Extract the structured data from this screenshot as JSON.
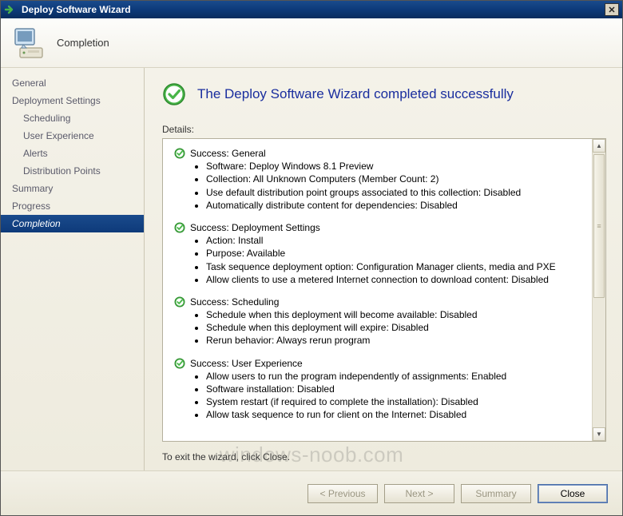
{
  "titlebar": {
    "title": "Deploy Software Wizard"
  },
  "header": {
    "step_title": "Completion"
  },
  "sidebar": {
    "items": [
      {
        "label": "General",
        "indent": false
      },
      {
        "label": "Deployment Settings",
        "indent": false
      },
      {
        "label": "Scheduling",
        "indent": true
      },
      {
        "label": "User Experience",
        "indent": true
      },
      {
        "label": "Alerts",
        "indent": true
      },
      {
        "label": "Distribution Points",
        "indent": true
      },
      {
        "label": "Summary",
        "indent": false
      },
      {
        "label": "Progress",
        "indent": false
      },
      {
        "label": "Completion",
        "indent": false,
        "active": true
      }
    ]
  },
  "main": {
    "headline": "The Deploy Software Wizard completed successfully",
    "details_label": "Details:",
    "sections": [
      {
        "title": "Success: General",
        "items": [
          "Software: Deploy Windows 8.1 Preview",
          "Collection: All Unknown Computers (Member Count: 2)",
          "Use default distribution point groups associated to this collection: Disabled",
          "Automatically distribute content for dependencies: Disabled"
        ]
      },
      {
        "title": "Success: Deployment Settings",
        "items": [
          "Action: Install",
          "Purpose: Available",
          "Task sequence deployment option: Configuration Manager clients, media and PXE",
          "Allow clients to use a metered Internet connection to download content: Disabled"
        ]
      },
      {
        "title": "Success: Scheduling",
        "items": [
          "Schedule when this deployment will become available: Disabled",
          "Schedule when this deployment will expire: Disabled",
          "Rerun behavior: Always rerun program"
        ]
      },
      {
        "title": "Success: User Experience",
        "items": [
          "Allow users to run the program independently of assignments: Enabled",
          "Software installation: Disabled",
          "System restart (if required to complete the installation): Disabled",
          "Allow task sequence to run for client on the Internet: Disabled"
        ]
      }
    ],
    "exit_note": "To exit the wizard, click Close."
  },
  "footer": {
    "previous": "< Previous",
    "next": "Next >",
    "summary": "Summary",
    "close": "Close"
  },
  "watermark": "windows-noob.com"
}
